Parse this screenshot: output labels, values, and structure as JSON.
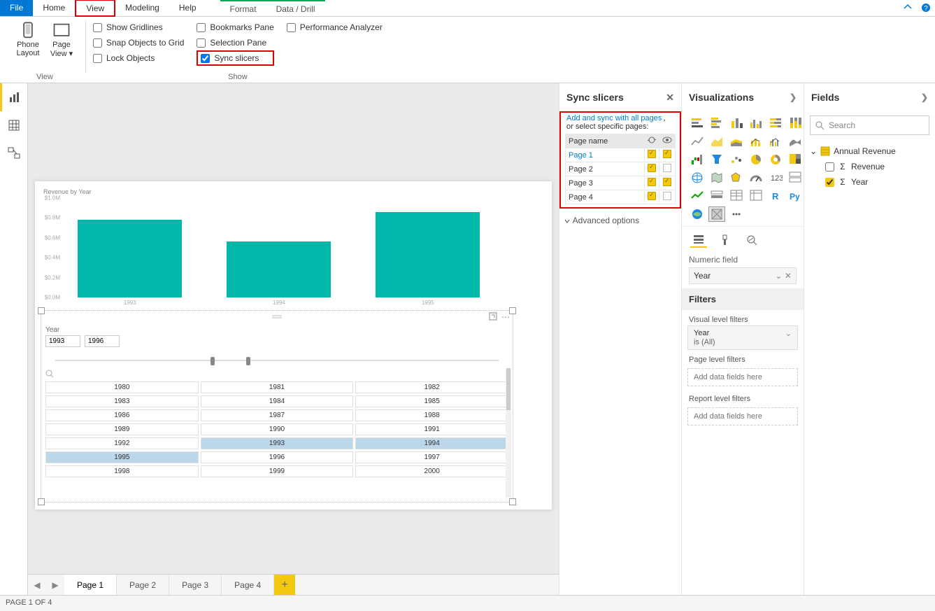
{
  "menu": {
    "file": "File",
    "home": "Home",
    "view": "View",
    "modeling": "Modeling",
    "help": "Help",
    "format": "Format",
    "datadrill": "Data / Drill"
  },
  "ribbon": {
    "phone_layout": "Phone Layout",
    "page_view": "Page View",
    "show_gridlines": "Show Gridlines",
    "snap_to_grid": "Snap Objects to Grid",
    "lock_objects": "Lock Objects",
    "bookmarks_pane": "Bookmarks Pane",
    "selection_pane": "Selection Pane",
    "sync_slicers": "Sync slicers",
    "perf_analyzer": "Performance Analyzer",
    "group_view": "View",
    "group_show": "Show"
  },
  "sync_panel": {
    "title": "Sync slicers",
    "hint_link": "Add and sync with all pages",
    "hint_tail": ",",
    "hint2": "or select specific pages:",
    "col_page": "Page name",
    "pages": [
      {
        "name": "Page 1",
        "sync": true,
        "visible": true,
        "active": true
      },
      {
        "name": "Page 2",
        "sync": true,
        "visible": false,
        "active": false
      },
      {
        "name": "Page 3",
        "sync": true,
        "visible": true,
        "active": false
      },
      {
        "name": "Page 4",
        "sync": true,
        "visible": false,
        "active": false
      }
    ],
    "advanced": "Advanced options"
  },
  "viz_panel": {
    "title": "Visualizations",
    "numeric_field_label": "Numeric field",
    "numeric_field_value": "Year",
    "filters_header": "Filters",
    "vlf_label": "Visual level filters",
    "vlf_field": "Year",
    "vlf_cond": "is (All)",
    "plf_label": "Page level filters",
    "plf_placeholder": "Add data fields here",
    "rlf_label": "Report level filters",
    "rlf_placeholder": "Add data fields here"
  },
  "fields_panel": {
    "title": "Fields",
    "search_placeholder": "Search",
    "table": "Annual Revenue",
    "fields": [
      {
        "name": "Revenue",
        "checked": false
      },
      {
        "name": "Year",
        "checked": true
      }
    ]
  },
  "pagetabs": {
    "tabs": [
      "Page 1",
      "Page 2",
      "Page 3",
      "Page 4"
    ],
    "active": 0
  },
  "status": "PAGE 1 OF 4",
  "chart_data": {
    "type": "bar",
    "title": "Revenue by Year",
    "categories": [
      "1993",
      "1994",
      "1995"
    ],
    "values": [
      0.78,
      0.56,
      0.86
    ],
    "ylabels": [
      "$0.0M",
      "$0.2M",
      "$0.4M",
      "$0.6M",
      "$0.8M",
      "$1.0M"
    ],
    "ylim": [
      0,
      1.0
    ],
    "y_unit": "M"
  },
  "slicer": {
    "label": "Year",
    "from": "1993",
    "to": "1996",
    "years": [
      "1980",
      "1981",
      "1982",
      "1983",
      "1984",
      "1985",
      "1986",
      "1987",
      "1988",
      "1989",
      "1990",
      "1991",
      "1992",
      "1993",
      "1994",
      "1995",
      "1996",
      "1997",
      "1998",
      "1999",
      "2000"
    ],
    "selected": [
      "1993",
      "1994",
      "1995"
    ]
  }
}
